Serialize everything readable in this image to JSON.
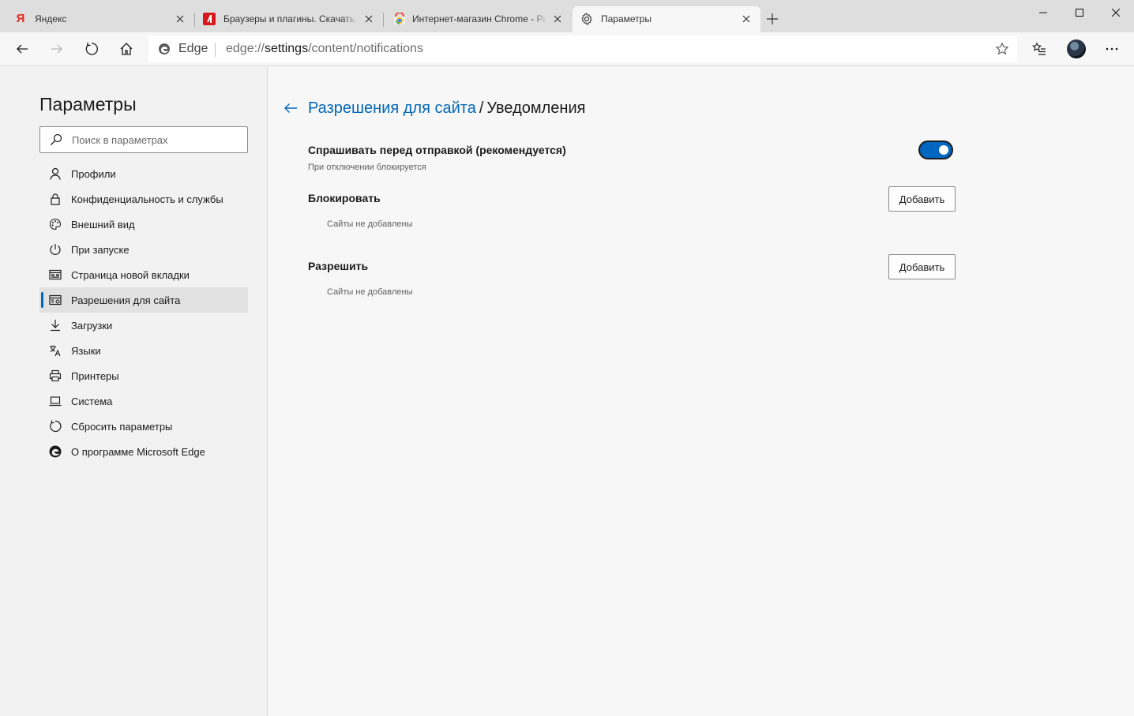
{
  "tabs": [
    {
      "title": "Яндекс",
      "icon": "yandex-icon",
      "active": false
    },
    {
      "title": "Браузеры и плагины. Скачать б",
      "icon": "browsers-site-icon",
      "active": false
    },
    {
      "title": "Интернет-магазин Chrome - Ра",
      "icon": "chrome-webstore-icon",
      "active": false
    },
    {
      "title": "Параметры",
      "icon": "gear-icon",
      "active": true
    }
  ],
  "yandex_glyph": "Я",
  "address": {
    "brand": "Edge",
    "scheme": "edge://",
    "host": "settings",
    "path": "/content/notifications"
  },
  "sidebar": {
    "title": "Параметры",
    "search_placeholder": "Поиск в параметрах",
    "items": [
      {
        "label": "Профили",
        "icon": "person-icon"
      },
      {
        "label": "Конфиденциальность и службы",
        "icon": "lock-icon"
      },
      {
        "label": "Внешний вид",
        "icon": "palette-icon"
      },
      {
        "label": "При запуске",
        "icon": "power-icon"
      },
      {
        "label": "Страница новой вкладки",
        "icon": "new-tab-page-icon"
      },
      {
        "label": "Разрешения для сайта",
        "icon": "site-permissions-icon",
        "active": true
      },
      {
        "label": "Загрузки",
        "icon": "download-icon"
      },
      {
        "label": "Языки",
        "icon": "languages-icon"
      },
      {
        "label": "Принтеры",
        "icon": "printer-icon"
      },
      {
        "label": "Система",
        "icon": "laptop-icon"
      },
      {
        "label": "Сбросить параметры",
        "icon": "reset-icon"
      },
      {
        "label": "О программе Microsoft Edge",
        "icon": "edge-logo-icon"
      }
    ]
  },
  "main": {
    "breadcrumb_parent": "Разрешения для сайта",
    "breadcrumb_sep": "/",
    "breadcrumb_current": "Уведомления",
    "ask": {
      "title": "Спрашивать перед отправкой (рекомендуется)",
      "subtitle": "При отключении блокируется",
      "enabled": true
    },
    "block": {
      "title": "Блокировать",
      "button": "Добавить",
      "empty": "Сайты не добавлены"
    },
    "allow": {
      "title": "Разрешить",
      "button": "Добавить",
      "empty": "Сайты не добавлены"
    }
  },
  "colors": {
    "accent": "#0067c0",
    "link": "#0067b8",
    "tabstrip": "#dedede",
    "sidebar": "#f2f2f2"
  }
}
